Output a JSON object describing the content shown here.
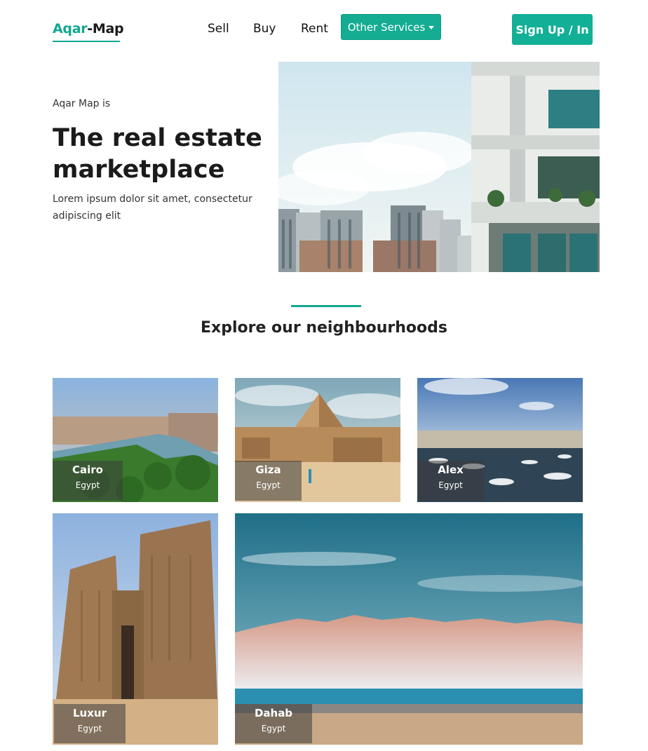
{
  "nav": {
    "logo_accent": "Aqar",
    "logo_rest": "-Map",
    "links": [
      "Sell",
      "Buy",
      "Rent"
    ],
    "other_services_label": "Other Services",
    "signup_label": "Sign Up / In"
  },
  "hero": {
    "intro": "Aqar Map is",
    "title": "The real estate marketplace",
    "description": "Lorem ipsum dolor sit amet, consectetur adipiscing elit"
  },
  "section": {
    "title": "Explore our neighbourhoods"
  },
  "neighbourhoods": [
    {
      "city": "Cairo",
      "country": "Egypt"
    },
    {
      "city": "Giza",
      "country": "Egypt"
    },
    {
      "city": "Alex",
      "country": "Egypt"
    },
    {
      "city": "Luxur",
      "country": "Egypt"
    },
    {
      "city": "Dahab",
      "country": "Egypt"
    }
  ],
  "colors": {
    "accent": "#12b096",
    "text_dark": "#1b1b1b"
  }
}
